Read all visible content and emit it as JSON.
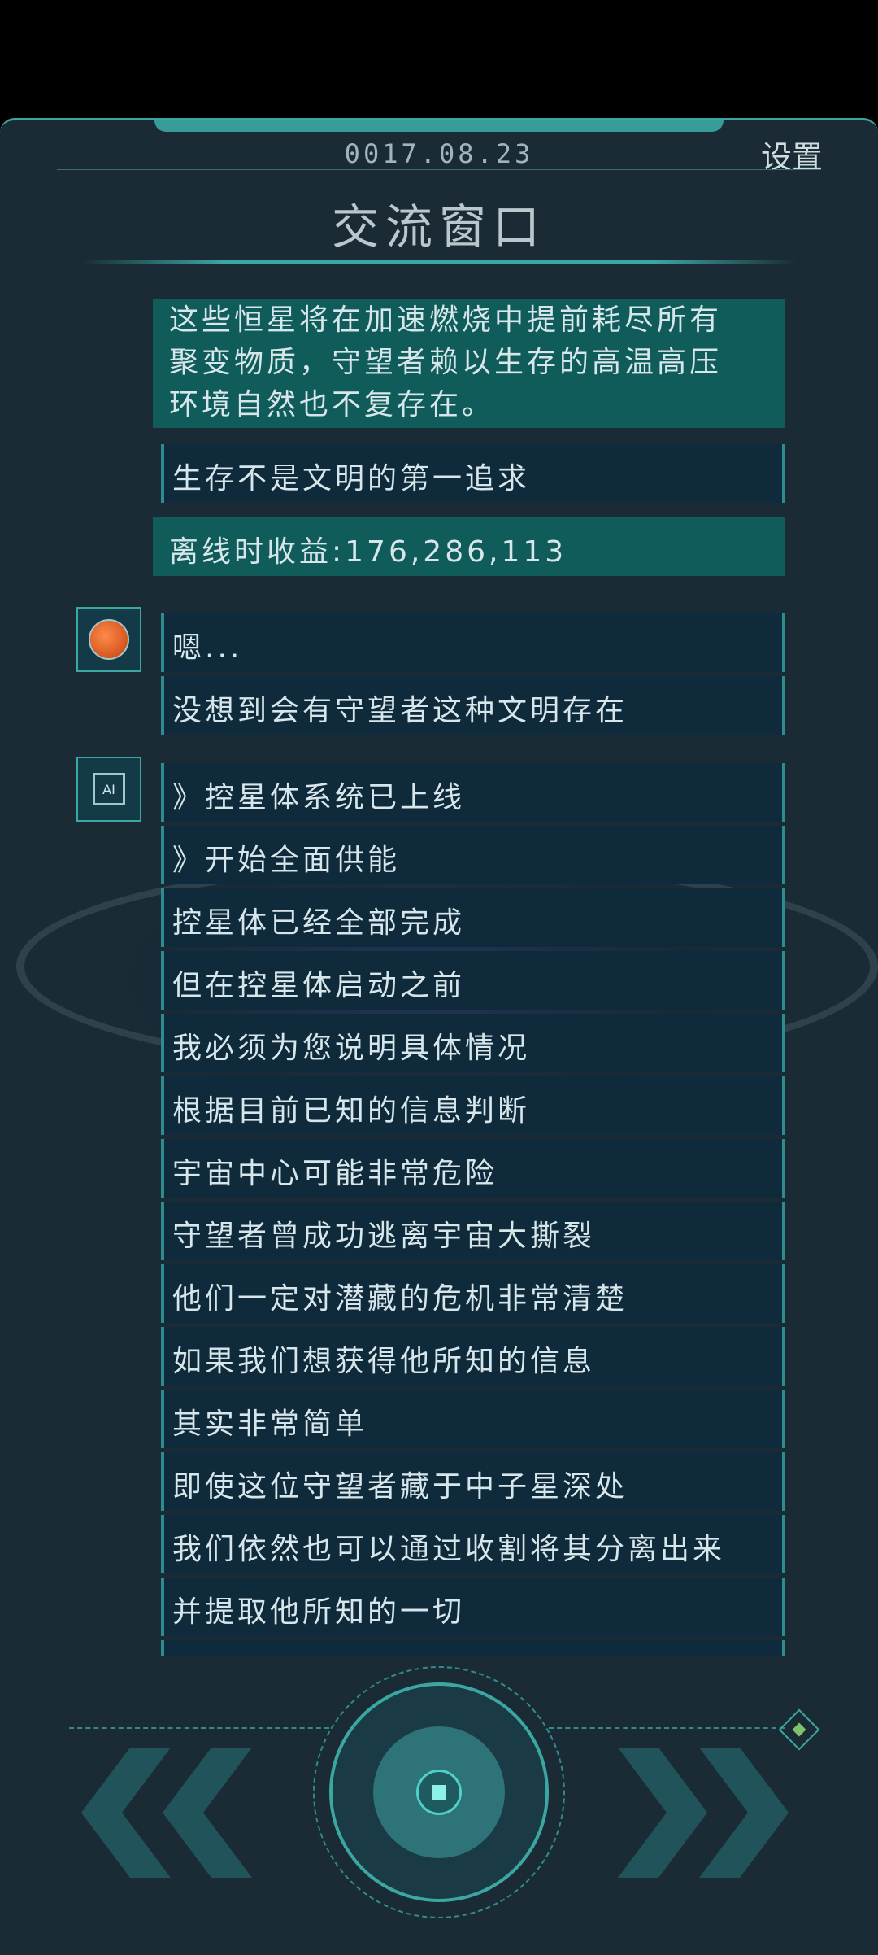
{
  "header": {
    "date": "0017.08.23",
    "settings_label": "设置",
    "title": "交流窗口"
  },
  "messages": {
    "intro_lines": [
      "这些恒星将在加速燃烧中提前耗尽所有",
      "聚变物质，守望者赖以生存的高温高压",
      "环境自然也不复存在。"
    ],
    "m1": "生存不是文明的第一追求",
    "offline_income": "离线时收益:176,286,113",
    "m3": "嗯...",
    "m4": "没想到会有守望者这种文明存在",
    "m5": "》控星体系统已上线",
    "m6": "》开始全面供能",
    "m7": "控星体已经全部完成",
    "m8": "但在控星体启动之前",
    "m9": "我必须为您说明具体情况",
    "m10": "根据目前已知的信息判断",
    "m11": "宇宙中心可能非常危险",
    "m12": "守望者曾成功逃离宇宙大撕裂",
    "m13": "他们一定对潜藏的危机非常清楚",
    "m14": "如果我们想获得他所知的信息",
    "m15": "其实非常简单",
    "m16": "即使这位守望者藏于中子星深处",
    "m17": "我们依然也可以通过收割将其分离出来",
    "m18": "并提取他所知的一切"
  },
  "avatars": {
    "ai_label": "AI"
  },
  "icons": {
    "back": "double-chevron-left-icon",
    "forward": "double-chevron-right-icon",
    "center": "stop-icon",
    "corner": "diamond-icon"
  },
  "colors": {
    "accent": "#3ba7a3",
    "panel": "#1a2b35",
    "bubble": "#0f2a3a",
    "highlight": "#0f5c5a"
  }
}
